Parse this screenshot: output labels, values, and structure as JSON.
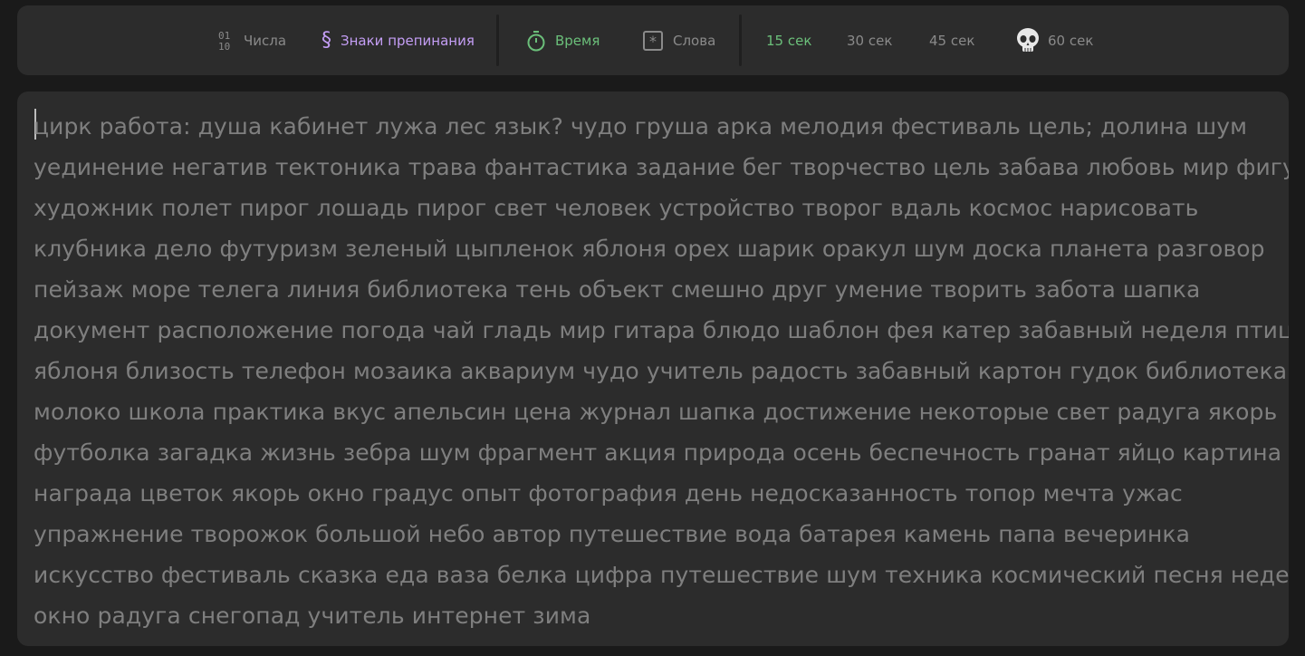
{
  "toolbar": {
    "numbers": {
      "label": "Числа",
      "icon": "numbers-icon"
    },
    "punctuation": {
      "label": "Знаки препинания",
      "icon": "section-sign-icon",
      "color": "#c49ef5"
    },
    "time": {
      "label": "Время",
      "icon": "stopwatch-icon",
      "color": "#6bbf7a"
    },
    "words": {
      "label": "Слова",
      "icon": "asterisk-box-icon"
    },
    "durations": [
      {
        "label": "15 сек",
        "active": true
      },
      {
        "label": "30 сек",
        "active": false
      },
      {
        "label": "45 сек",
        "active": false
      },
      {
        "label": "60 сек",
        "active": false,
        "icon": "skull-icon"
      }
    ]
  },
  "text": {
    "lines": [
      "цирк работа: душа кабинет лужа лес язык? чудо груша арка мелодия фестиваль цель; долина шум",
      "уединение негатив тектоника трава фантастика задание бег творчество цель забава любовь мир фигура",
      "художник полет пирог лошадь пирог свет человек устройство творог вдаль космос нарисовать",
      "клубника дело футуризм зеленый цыпленок яблоня орех шарик оракул шум доска планета разговор",
      "пейзаж море телега линия библиотека тень объект смешно друг умение творить забота шапка",
      "документ расположение погода чай гладь мир гитара блюдо шаблон фея катер забавный неделя птица",
      "яблоня близость телефон мозаика аквариум чудо учитель радость забавный картон гудок библиотека",
      "молоко школа практика вкус апельсин цена журнал шапка достижение некоторые свет радуга якорь",
      "футболка загадка жизнь зебра шум фрагмент акция природа осень беспечность гранат яйцо картина",
      "награда цветок якорь окно градус опыт фотография день недосказанность топор мечта ужас",
      "упражнение творожок большой небо автор путешествие вода батарея камень папа вечеринка",
      "искусство фестиваль сказка еда ваза белка цифра путешествие шум техника космический песня неделя",
      "окно радуга снегопад учитель интернет зима"
    ]
  }
}
